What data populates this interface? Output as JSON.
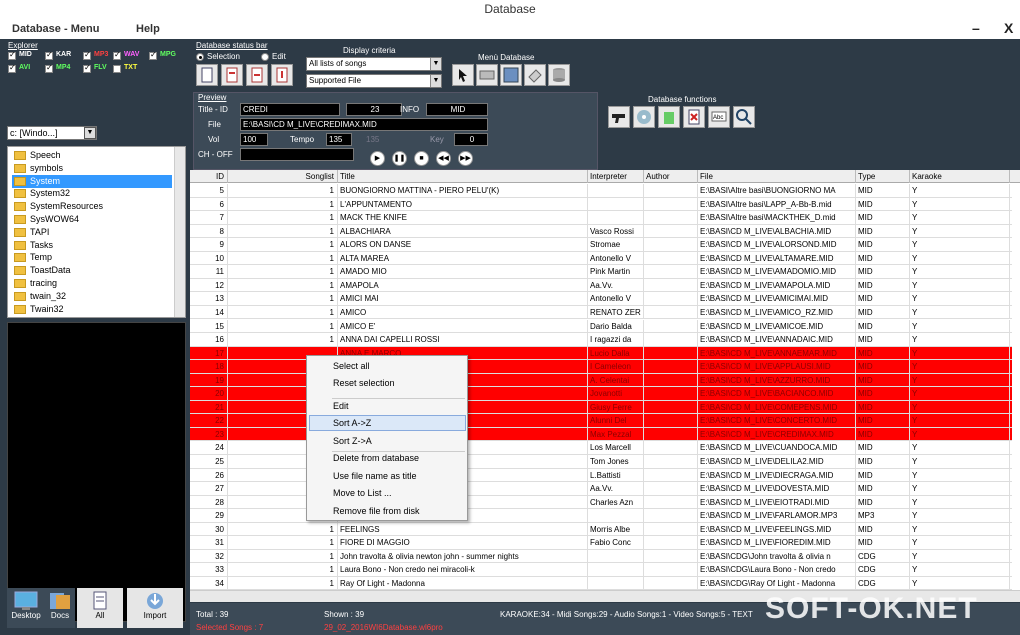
{
  "window": {
    "title": "Database"
  },
  "menubar": {
    "db_menu": "Database - Menu",
    "help": "Help",
    "min": "–",
    "close": "X"
  },
  "explorer": {
    "label": "Explorer",
    "formats": [
      {
        "name": "MID",
        "color": "#ffffff",
        "checked": true
      },
      {
        "name": "KAR",
        "color": "#ffffff",
        "checked": true
      },
      {
        "name": "MP3",
        "color": "#ff4040",
        "checked": true
      },
      {
        "name": "WAV",
        "color": "#ff60ff",
        "checked": true
      },
      {
        "name": "MPG",
        "color": "#60ff60",
        "checked": true
      },
      {
        "name": "AVI",
        "color": "#60ff60",
        "checked": true
      },
      {
        "name": "MP4",
        "color": "#60ff60",
        "checked": true
      },
      {
        "name": "FLV",
        "color": "#60ff60",
        "checked": true
      },
      {
        "name": "TXT",
        "color": "#ffff40",
        "checked": false
      }
    ],
    "drive": "c: [Windo...]",
    "folders": [
      "Speech",
      "symbols",
      "System",
      "System32",
      "SystemResources",
      "SysWOW64",
      "TAPI",
      "Tasks",
      "Temp",
      "ToastData",
      "tracing",
      "twain_32",
      "Twain32"
    ],
    "selected_folder": "System"
  },
  "bottom_buttons": {
    "desktop": "Desktop",
    "docs": "Docs",
    "all": "All",
    "import": "Import"
  },
  "status_bar": {
    "title": "Database status bar",
    "selection": "Selection",
    "edit": "Edit"
  },
  "display_criteria": {
    "title": "Display criteria",
    "list": "All lists of songs",
    "filter": "Supported File"
  },
  "menu_database": {
    "title": "Menù Database"
  },
  "db_functions": {
    "title": "Database functions"
  },
  "preview": {
    "title": "Preview",
    "title_id_label": "Title - ID",
    "title_value": "CREDI",
    "id_value": "23",
    "info_label": "INFO",
    "info_value": "MID",
    "file_label": "File",
    "file_value": "E:\\BASI\\CD M_LIVE\\CREDIMAX.MID",
    "vol_label": "Vol",
    "vol_value": "100",
    "tempo_label": "Tempo",
    "tempo_value": "135",
    "tempo_dim": "135",
    "key_label": "Key",
    "key_value": "0",
    "ch_label": "CH - OFF"
  },
  "table": {
    "columns": [
      "ID",
      "Songlist",
      "Title",
      "Interpreter",
      "Author",
      "File",
      "Type",
      "Karaoke"
    ],
    "rows": [
      [
        "5",
        "1",
        "BUONGIORNO MATTINA - PIERO PELU'(K)",
        "",
        "",
        "E:\\BASI\\Altre basi\\BUONGIORNO MA",
        "MID",
        "Y"
      ],
      [
        "6",
        "1",
        "L'APPUNTAMENTO",
        "",
        "",
        "E:\\BASI\\Altre basi\\LAPP_A-Bb-B.mid",
        "MID",
        "Y"
      ],
      [
        "7",
        "1",
        "MACK THE KNIFE",
        "",
        "",
        "E:\\BASI\\Altre basi\\MACKTHEK_D.mid",
        "MID",
        "Y"
      ],
      [
        "8",
        "1",
        "ALBACHIARA",
        "Vasco Rossi",
        "",
        "E:\\BASI\\CD M_LIVE\\ALBACHIA.MID",
        "MID",
        "Y"
      ],
      [
        "9",
        "1",
        "ALORS ON DANSE",
        "Stromae",
        "",
        "E:\\BASI\\CD M_LIVE\\ALORSOND.MID",
        "MID",
        "Y"
      ],
      [
        "10",
        "1",
        "ALTA MAREA",
        "Antonello V",
        "",
        "E:\\BASI\\CD M_LIVE\\ALTAMARE.MID",
        "MID",
        "Y"
      ],
      [
        "11",
        "1",
        "AMADO MIO",
        "Pink Martin",
        "",
        "E:\\BASI\\CD M_LIVE\\AMADOMIO.MID",
        "MID",
        "Y"
      ],
      [
        "12",
        "1",
        "AMAPOLA",
        "Aa.Vv.",
        "",
        "E:\\BASI\\CD M_LIVE\\AMAPOLA.MID",
        "MID",
        "Y"
      ],
      [
        "13",
        "1",
        "AMICI MAI",
        "Antonello V",
        "",
        "E:\\BASI\\CD M_LIVE\\AMICIMAI.MID",
        "MID",
        "Y"
      ],
      [
        "14",
        "1",
        "AMICO",
        "RENATO ZER",
        "",
        "E:\\BASI\\CD M_LIVE\\AMICO_RZ.MID",
        "MID",
        "Y"
      ],
      [
        "15",
        "1",
        "AMICO E'",
        "Dario Balda",
        "",
        "E:\\BASI\\CD M_LIVE\\AMICOE.MID",
        "MID",
        "Y"
      ],
      [
        "16",
        "1",
        "ANNA DAI CAPELLI ROSSI",
        "I ragazzi da",
        "",
        "E:\\BASI\\CD M_LIVE\\ANNADAIC.MID",
        "MID",
        "Y"
      ],
      [
        "17",
        "",
        "ANNA E MARCO",
        "Lucio Dalla",
        "",
        "E:\\BASI\\CD M_LIVE\\ANNAEMAR.MID",
        "MID",
        "Y"
      ],
      [
        "18",
        "",
        "",
        "I Cameleon",
        "",
        "E:\\BASI\\CD M_LIVE\\APPLAUSI.MID",
        "MID",
        "Y"
      ],
      [
        "19",
        "",
        "",
        "A. Celentai",
        "",
        "E:\\BASI\\CD M_LIVE\\AZZURRO.MID",
        "MID",
        "Y"
      ],
      [
        "20",
        "",
        "",
        "Jovanotti",
        "",
        "E:\\BASI\\CD M_LIVE\\BACIANCO.MID",
        "MID",
        "Y"
      ],
      [
        "21",
        "",
        "",
        "Giusy Ferre",
        "",
        "E:\\BASI\\CD M_LIVE\\COMEPENS.MID",
        "MID",
        "Y"
      ],
      [
        "22",
        "",
        "",
        "Alunni Del",
        "",
        "E:\\BASI\\CD M_LIVE\\CONCERTO.MID",
        "MID",
        "Y"
      ],
      [
        "23",
        "",
        "",
        "Max Pezzal",
        "",
        "E:\\BASI\\CD M_LIVE\\CREDIMAX.MID",
        "MID",
        "Y"
      ],
      [
        "24",
        "",
        "",
        "Los Marcell",
        "",
        "E:\\BASI\\CD M_LIVE\\CUANDOCA.MID",
        "MID",
        "Y"
      ],
      [
        "25",
        "",
        "",
        "Tom Jones",
        "",
        "E:\\BASI\\CD M_LIVE\\DELILA2.MID",
        "MID",
        "Y"
      ],
      [
        "26",
        "",
        "",
        "L.Battisti",
        "",
        "E:\\BASI\\CD M_LIVE\\DIECRAGA.MID",
        "MID",
        "Y"
      ],
      [
        "27",
        "",
        "",
        "Aa.Vv.",
        "",
        "E:\\BASI\\CD M_LIVE\\DOVESTA.MID",
        "MID",
        "Y"
      ],
      [
        "28",
        "",
        "",
        "Charles Azn",
        "",
        "E:\\BASI\\CD M_LIVE\\EIOTRADI.MID",
        "MID",
        "Y"
      ],
      [
        "29",
        "",
        "",
        "",
        "",
        "E:\\BASI\\CD M_LIVE\\FARLAMOR.MP3",
        "MP3",
        "Y"
      ],
      [
        "30",
        "1",
        "FEELINGS",
        "Morris Albe",
        "",
        "E:\\BASI\\CD M_LIVE\\FEELINGS.MID",
        "MID",
        "Y"
      ],
      [
        "31",
        "1",
        "FIORE DI MAGGIO",
        "Fabio Conc",
        "",
        "E:\\BASI\\CD M_LIVE\\FIOREDIM.MID",
        "MID",
        "Y"
      ],
      [
        "32",
        "1",
        "John travolta & olivia newton john - summer nights",
        "",
        "",
        "E:\\BASI\\CDG\\John travolta & olivia n",
        "CDG",
        "Y"
      ],
      [
        "33",
        "1",
        "Laura Bono - Non credo nei miracoli-k",
        "",
        "",
        "E:\\BASI\\CDG\\Laura Bono - Non credo",
        "CDG",
        "Y"
      ],
      [
        "34",
        "1",
        "Ray Of Light - Madonna",
        "",
        "",
        "E:\\BASI\\CDG\\Ray Of Light - Madonna",
        "CDG",
        "Y"
      ]
    ]
  },
  "context_menu": {
    "items": [
      "Select all",
      "Reset selection",
      "Edit",
      "Sort A->Z",
      "Sort Z->A",
      "Delete from database",
      "Use file name as title",
      "Move to List ...",
      "Remove file from disk"
    ],
    "highlighted": "Sort A->Z"
  },
  "footer": {
    "total": "Total : 39",
    "shown": "Shown : 39",
    "selected": "Selected Songs : 7",
    "dbfile": "29_02_2016WI6Database.wl6pro",
    "stats": "KARAOKE:34 - Midi Songs:29 - Audio Songs:1 - Video Songs:5 - TEXT"
  },
  "watermark": "SOFT-OK.NET",
  "colors": {
    "highlight_row": "#ff0000",
    "selected_folder": "#3399ff",
    "panel": "#3c4a57"
  }
}
